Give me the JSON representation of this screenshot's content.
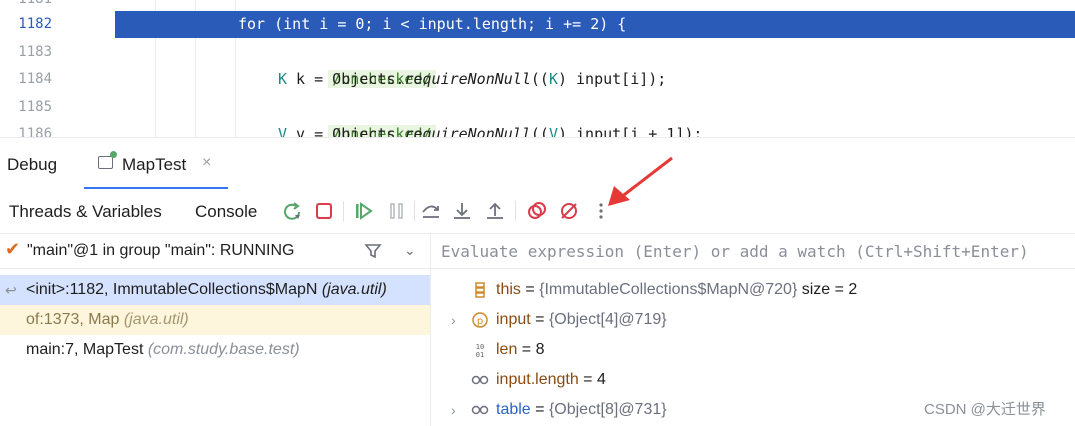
{
  "editor": {
    "lines": [
      {
        "num": "1181",
        "text": ""
      },
      {
        "num": "1182",
        "text": "for (int i = 0; i < input.length; i += 2) {",
        "exec": true
      },
      {
        "num": "1183",
        "comment": "/unchecked/"
      },
      {
        "num": "1184",
        "p1": "K",
        "p2": " k = Objects.",
        "p3": "requireNonNull",
        "p4": "((",
        "p5": "K",
        "p6": ") input[i]);"
      },
      {
        "num": "1185",
        "comment": "/unchecked/"
      },
      {
        "num": "1186",
        "p1": "V",
        "p2": " v = Objects.",
        "p3": "requireNonNull",
        "p4": "((",
        "p5": "V",
        "p6": ") input[i + 1]);"
      }
    ]
  },
  "debug": {
    "title": "Debug",
    "session": "MapTest",
    "close": "×"
  },
  "toolbar": {
    "tabs": [
      "Threads & Variables",
      "Console"
    ],
    "buttons": [
      "rerun-icon",
      "stop-icon",
      "resume-icon",
      "pause-icon",
      "step-over-icon",
      "step-into-icon",
      "step-out-icon",
      "view-breakpoints-icon",
      "mute-breakpoints-icon",
      "more-icon"
    ]
  },
  "threads": {
    "selected": "\"main\"@1 in group \"main\": RUNNING",
    "frames": [
      {
        "method": "<init>:1182, ImmutableCollections$MapN ",
        "pkg": "(java.util)"
      },
      {
        "method": "of:1373, Map ",
        "pkg": "(java.util)"
      },
      {
        "method": "main:7, MapTest ",
        "pkg": "(com.study.base.test)"
      }
    ]
  },
  "variables": {
    "watch_placeholder": "Evaluate expression (Enter) or add a watch (Ctrl+Shift+Enter)",
    "rows": [
      {
        "name": "this",
        "eq": " = ",
        "value": "{ImmutableCollections$MapN@720}",
        "extra": "  size = 2",
        "icon": "object-icon"
      },
      {
        "name": "input",
        "eq": " = ",
        "value": "{Object[4]@719}",
        "extra": "",
        "icon": "parameter-icon"
      },
      {
        "name": "len",
        "eq": " = ",
        "value": "",
        "extra": "8",
        "icon": "primitive-icon"
      },
      {
        "name": "input.length",
        "eq": " = ",
        "value": "",
        "extra": "4",
        "icon": "watch-icon"
      },
      {
        "name": "table",
        "eq": " = ",
        "value": "{Object[8]@731}",
        "extra": "",
        "icon": "watch-icon"
      }
    ]
  },
  "watermark": "CSDN @大迁世界"
}
